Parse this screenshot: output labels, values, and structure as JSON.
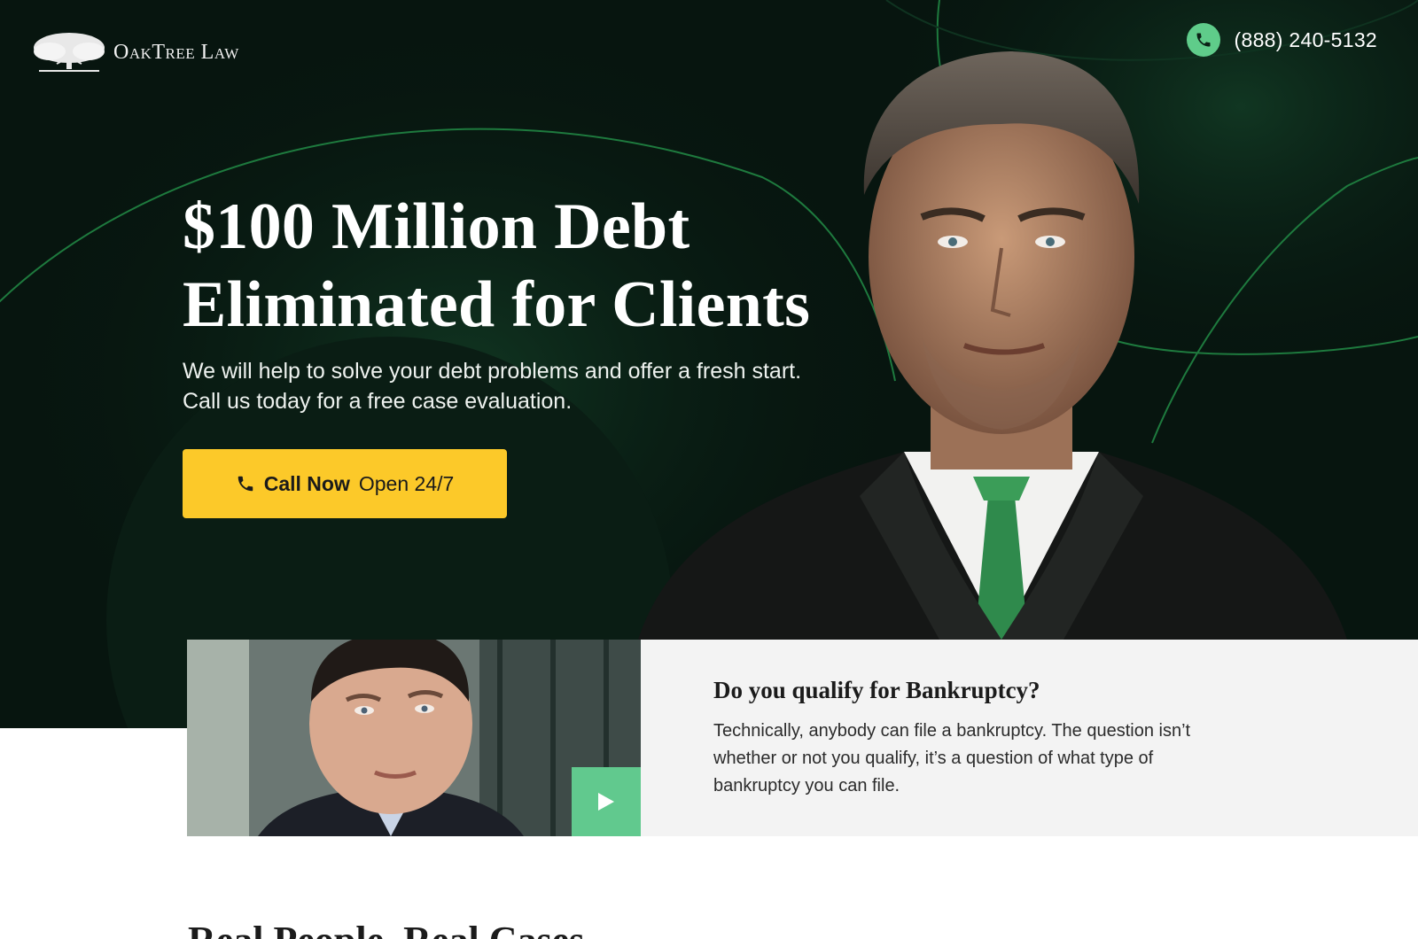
{
  "header": {
    "logo_text": "OakTree Law",
    "phone_number": "(888) 240-5132"
  },
  "hero": {
    "headline_line1": "$100 Million Debt",
    "headline_line2": "Eliminated for Clients",
    "subtext": "We will help to solve your debt problems and offer a fresh start. Call us today for a free case evaluation.",
    "cta_strong": "Call Now",
    "cta_light": "Open 24/7"
  },
  "video": {
    "icon": "play-icon"
  },
  "info": {
    "title": "Do you qualify for Bankruptcy?",
    "text": "Technically, anybody can file a bankruptcy. The question isn’t whether or not you qualify, it’s a question of what type of bankruptcy you can file."
  },
  "section": {
    "title": "Real People, Real Cases"
  },
  "colors": {
    "hero_bg": "#07150f",
    "accent_green": "#5fcc8a",
    "cta_yellow": "#fcc929",
    "info_bg": "#f3f3f3"
  }
}
